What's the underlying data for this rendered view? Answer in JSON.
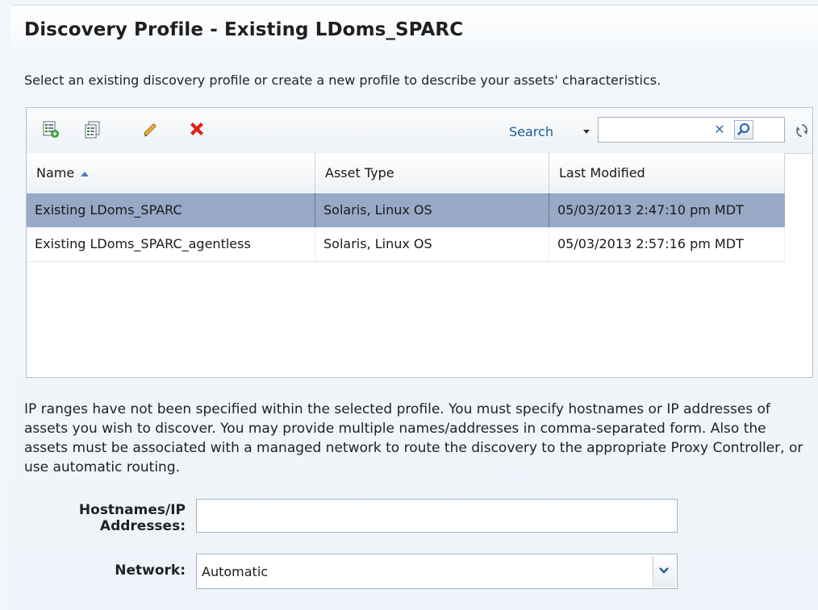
{
  "header": {
    "title": "Discovery Profile - Existing LDoms_SPARC",
    "description": "Select an existing discovery profile or create a new profile to describe your assets' characteristics."
  },
  "toolbar": {
    "icons": [
      "create-profile-icon",
      "duplicate-profile-icon",
      "edit-pencil-icon",
      "delete-x-icon"
    ],
    "search_label": "Search",
    "search_value": "",
    "refresh_icon": "refresh-icon"
  },
  "table": {
    "columns": [
      "Name",
      "Asset Type",
      "Last Modified"
    ],
    "sort_column": "Name",
    "sort_direction": "ascending",
    "rows": [
      {
        "name": "Existing LDoms_SPARC",
        "asset_type": "Solaris, Linux OS",
        "last_modified": "05/03/2013 2:47:10 pm MDT",
        "selected": true
      },
      {
        "name": "Existing LDoms_SPARC_agentless",
        "asset_type": "Solaris, Linux OS",
        "last_modified": "05/03/2013 2:57:16 pm MDT",
        "selected": false
      }
    ]
  },
  "info_text": "IP ranges have not been specified within the selected profile. You must specify hostnames or IP addresses of assets you wish to discover. You may provide multiple names/addresses in comma-separated form. Also the assets must be associated with a managed network to route the discovery to the appropriate Proxy Controller, or use automatic routing.",
  "form": {
    "hostnames_label_line1": "Hostnames/IP",
    "hostnames_label_line2": "Addresses:",
    "hostnames_value": "",
    "network_label": "Network:",
    "network_value": "Automatic"
  },
  "colors": {
    "selected_row": "#97a9c6",
    "link_blue": "#1b5a9a",
    "delete_red": "#e0201b"
  }
}
